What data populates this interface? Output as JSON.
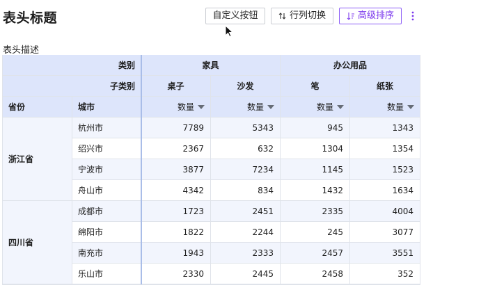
{
  "header": {
    "title": "表头标题",
    "description": "表头描述",
    "buttons": {
      "custom": "自定义按钮",
      "switch": "行列切换",
      "sort": "高级排序"
    },
    "accent_color": "#7c3aed"
  },
  "table": {
    "corner": {
      "category_label": "类别",
      "subcategory_label": "子类别",
      "province_header": "省份",
      "city_header": "城市"
    },
    "categories": [
      {
        "name": "家具",
        "subs": [
          "桌子",
          "沙发"
        ]
      },
      {
        "name": "办公用品",
        "subs": [
          "笔",
          "纸张"
        ]
      }
    ],
    "measure_label": "数量",
    "provinces": [
      {
        "name": "浙江省",
        "rows": [
          {
            "city": "杭州市",
            "values": [
              7789,
              5343,
              945,
              1343
            ]
          },
          {
            "city": "绍兴市",
            "values": [
              2367,
              632,
              1304,
              1354
            ]
          },
          {
            "city": "宁波市",
            "values": [
              3877,
              7234,
              1145,
              1523
            ]
          },
          {
            "city": "舟山市",
            "values": [
              4342,
              834,
              1432,
              1634
            ]
          }
        ]
      },
      {
        "name": "四川省",
        "rows": [
          {
            "city": "成都市",
            "values": [
              1723,
              2451,
              2335,
              4004
            ]
          },
          {
            "city": "绵阳市",
            "values": [
              1822,
              2244,
              245,
              3077
            ]
          },
          {
            "city": "南充市",
            "values": [
              1943,
              2333,
              2457,
              3551
            ]
          },
          {
            "city": "乐山市",
            "values": [
              2330,
              2445,
              2458,
              352
            ]
          }
        ]
      }
    ]
  }
}
